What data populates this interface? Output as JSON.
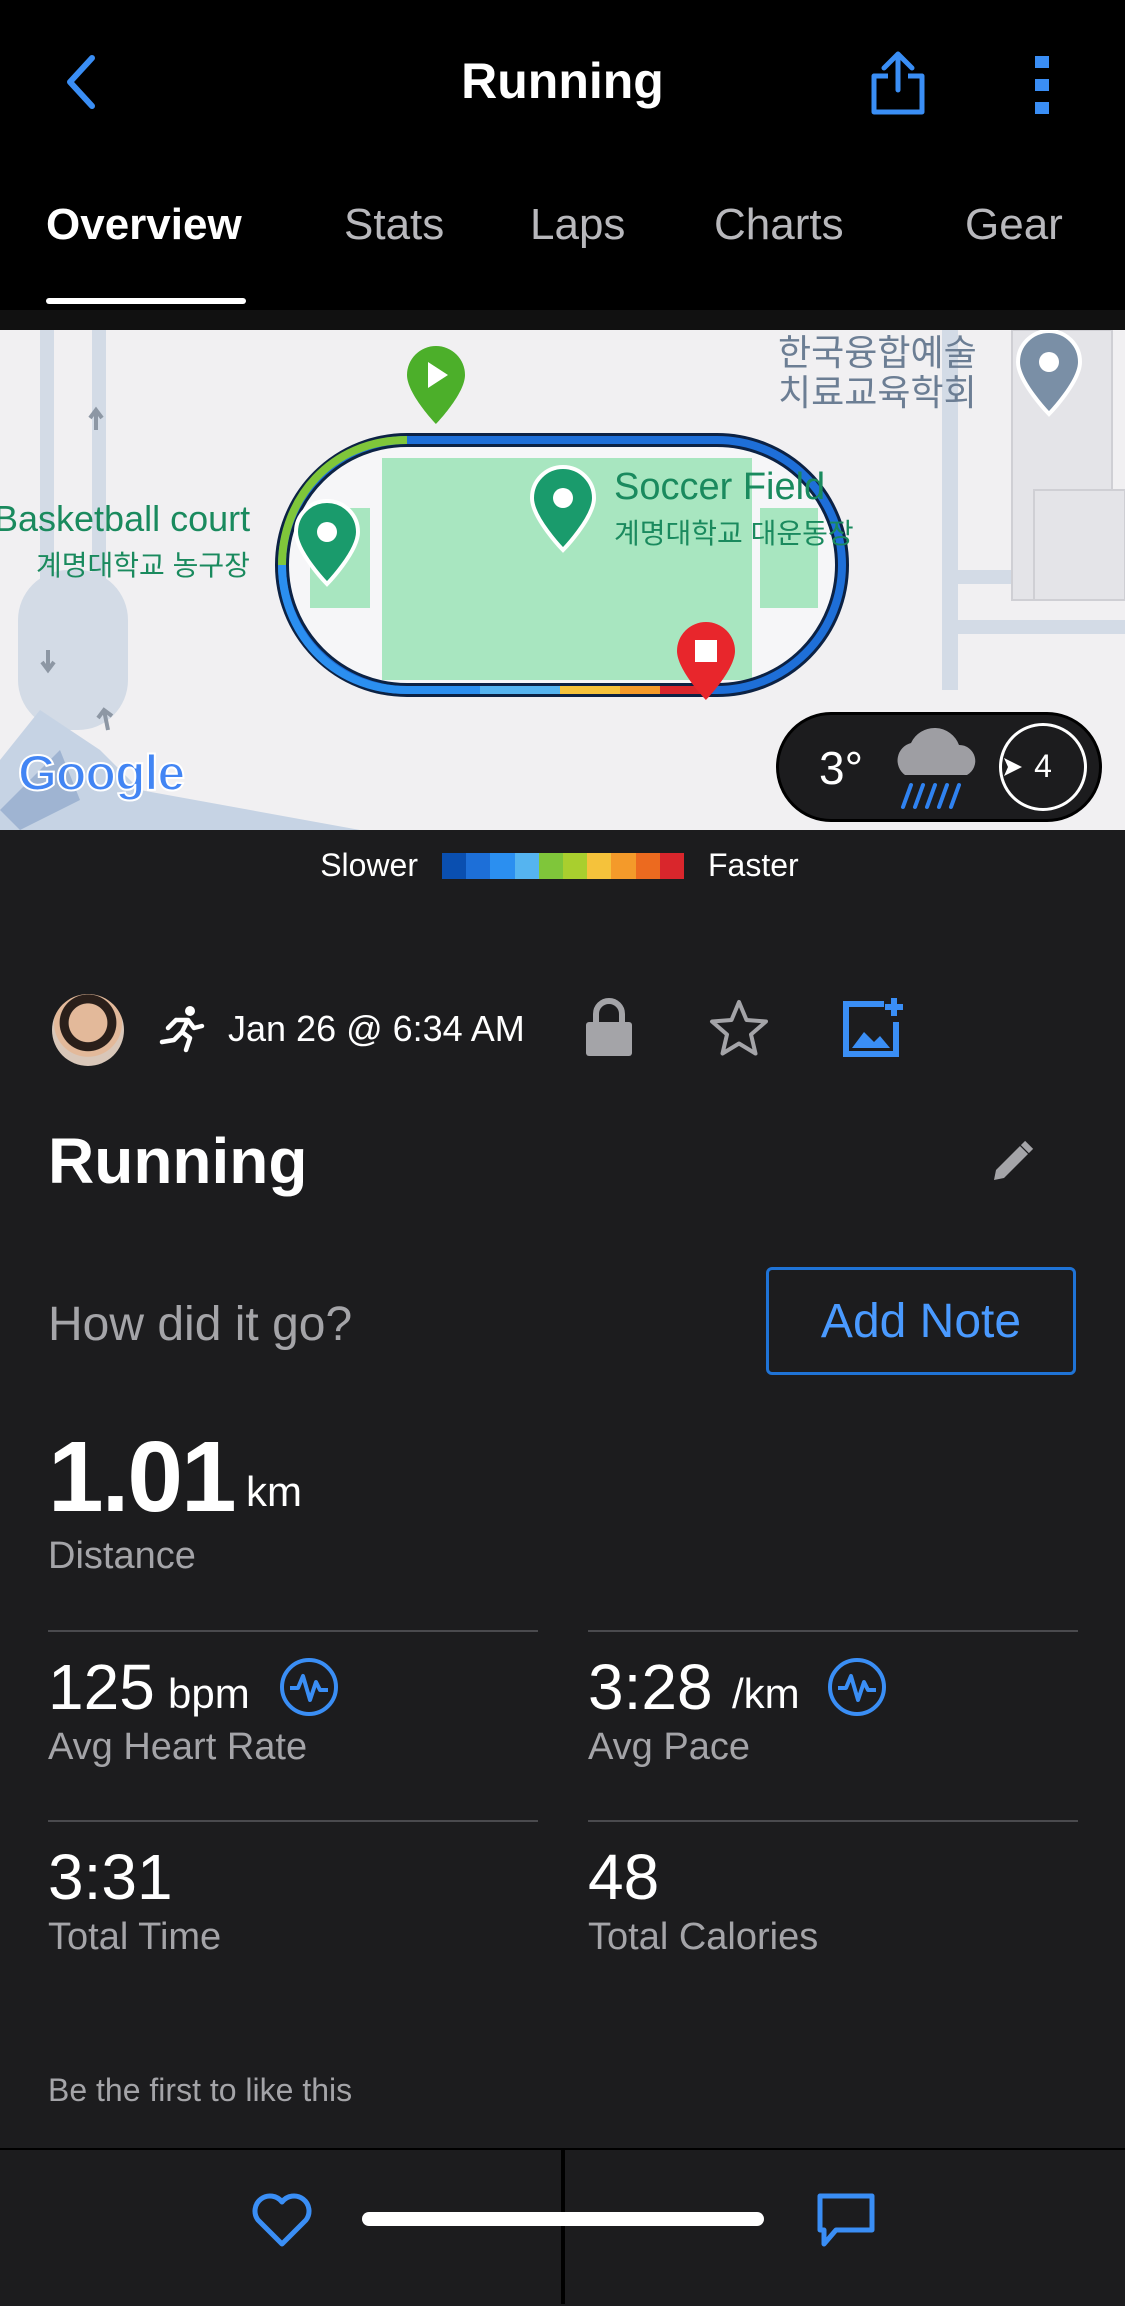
{
  "header": {
    "title": "Running",
    "tabs": [
      "Overview",
      "Stats",
      "Laps",
      "Charts",
      "Gear"
    ],
    "active_tab": "Overview"
  },
  "map": {
    "labels": {
      "basketball_en": "Basketball court",
      "basketball_ko": "계명대학교 농구장",
      "soccer_en": "Soccer Field",
      "soccer_ko": "계명대학교 대운동장",
      "poi_top_line1": "한국융합예술",
      "poi_top_line2": "치료교육학회",
      "google": "Google"
    },
    "weather": {
      "temperature": "3°",
      "wind": "4",
      "icon": "rain-cloud-icon"
    }
  },
  "legend": {
    "slower": "Slower",
    "faster": "Faster",
    "colors": [
      "#0a4fb0",
      "#1d6fd8",
      "#2b8ff0",
      "#55b4f0",
      "#7fc63a",
      "#a9cf2e",
      "#f5c23b",
      "#f49a2a",
      "#ec6a1f",
      "#d9262c"
    ]
  },
  "activity": {
    "date": "Jan 26 @ 6:34 AM",
    "name": "Running",
    "prompt": "How did it go?",
    "add_note": "Add Note"
  },
  "stats": {
    "distance": {
      "value": "1.01",
      "unit": "km",
      "label": "Distance"
    },
    "heart_rate": {
      "value": "125",
      "unit": "bpm",
      "label": "Avg Heart Rate"
    },
    "pace": {
      "value": "3:28",
      "unit": "/km",
      "label": "Avg Pace"
    },
    "time": {
      "value": "3:31",
      "label": "Total Time"
    },
    "calories": {
      "value": "48",
      "label": "Total Calories"
    }
  },
  "social": {
    "likes_text": "Be the first to like this"
  },
  "colors": {
    "accent": "#3a8ef5",
    "background": "#1c1c1e",
    "header": "#000000"
  }
}
